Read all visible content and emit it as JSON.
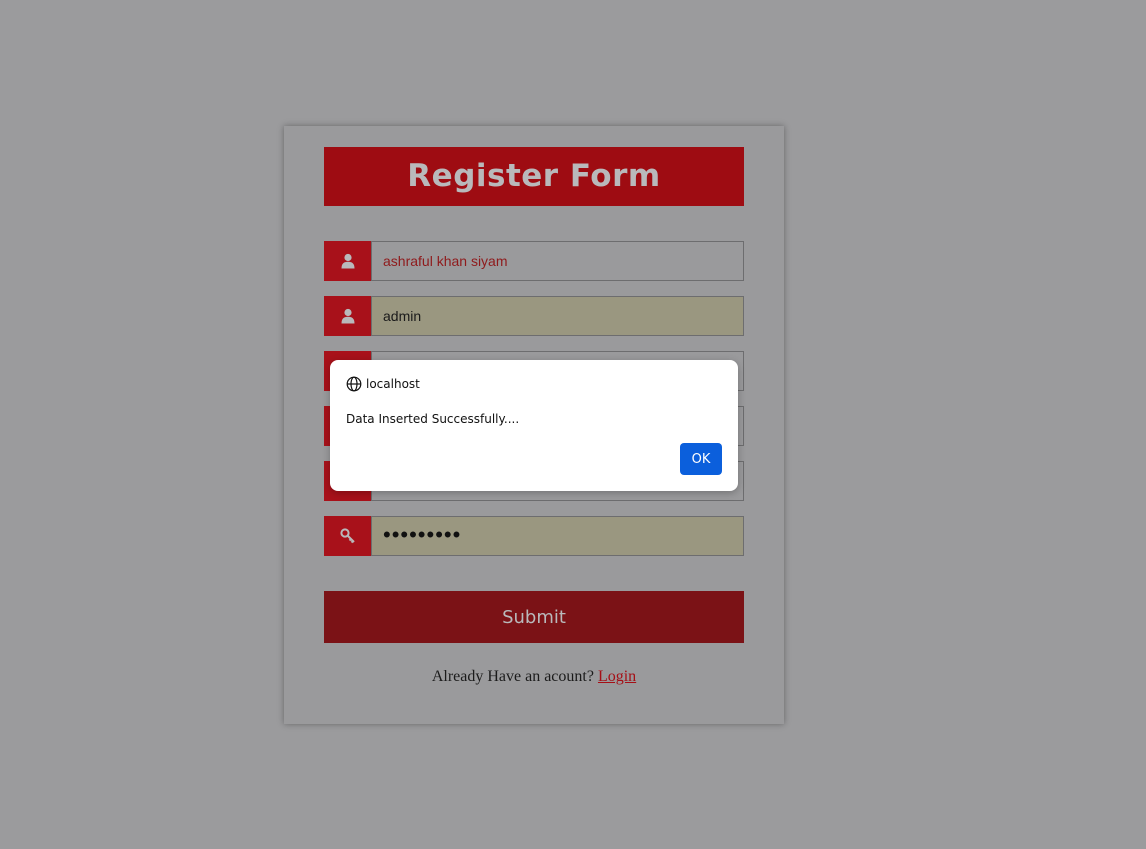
{
  "form": {
    "title": "Register Form",
    "fields": [
      {
        "icon": "user-icon",
        "value": "ashraful khan siyam",
        "placeholder": ""
      },
      {
        "icon": "user-icon",
        "value": "admin",
        "placeholder": ""
      },
      {
        "icon": "envelope-icon",
        "value": "",
        "placeholder": ""
      },
      {
        "icon": "phone-icon",
        "value": "",
        "placeholder": ""
      },
      {
        "icon": "key-icon",
        "value": "",
        "placeholder": ""
      },
      {
        "icon": "key-icon",
        "value": "•••••••••",
        "placeholder": ""
      }
    ],
    "submit_label": "Submit",
    "login_prompt": "Already Have an acount?",
    "login_link": "Login"
  },
  "dialog": {
    "origin": "localhost",
    "message": "Data Inserted Successfully....",
    "ok_label": "OK"
  },
  "colors": {
    "accent_red": "#a8111a",
    "submit_red": "#7b1216",
    "ok_blue": "#0b5fdc",
    "autofill_bg": "#9a9780"
  }
}
